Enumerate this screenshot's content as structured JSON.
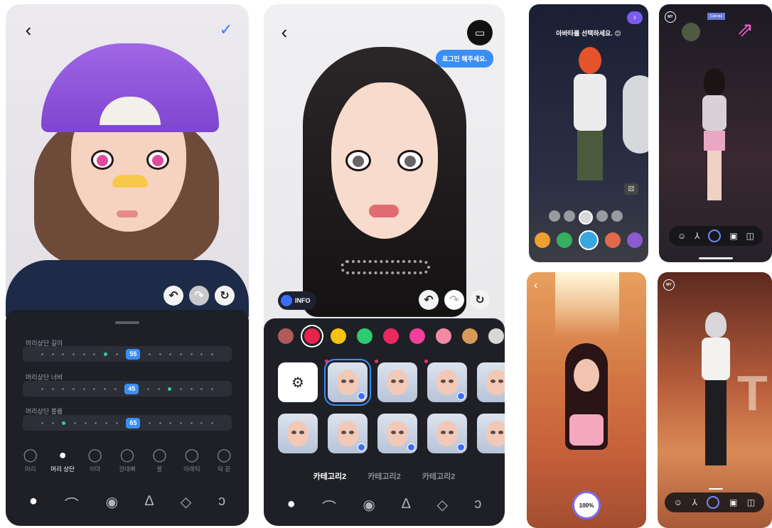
{
  "panel1": {
    "sliders": [
      {
        "label": "머리상단 길이",
        "value": "55"
      },
      {
        "label": "머리상단 너비",
        "value": "45"
      },
      {
        "label": "머리상단 볼륨",
        "value": "65"
      }
    ],
    "categories": [
      {
        "label": "머리",
        "icon": "head-outline-icon"
      },
      {
        "label": "머리 상단",
        "icon": "head-top-icon"
      },
      {
        "label": "이마",
        "icon": "forehead-icon"
      },
      {
        "label": "광대뼈",
        "icon": "cheekbone-icon"
      },
      {
        "label": "볼",
        "icon": "cheek-icon"
      },
      {
        "label": "아래턱",
        "icon": "jaw-icon"
      },
      {
        "label": "턱 끝",
        "icon": "chin-icon"
      }
    ],
    "active_category": "머리 상단",
    "tabs": [
      "face-icon",
      "eyebrow-icon",
      "eye-icon",
      "nose-icon",
      "lips-icon",
      "ear-icon"
    ]
  },
  "panel2": {
    "tooltip": "로그인 해주세요.",
    "info_label": "INFO",
    "swatches": [
      "#b05a5a",
      "#e8244e",
      "#f4c210",
      "#2ecc71",
      "#ea2a5e",
      "#f0409a",
      "#f28aa6",
      "#d79a58",
      "#d8d8d8"
    ],
    "tabs_text": [
      "카테고리2",
      "카테고리2",
      "카테고리2"
    ],
    "active_tab": "카테고리2"
  },
  "panel3a": {
    "title": "아바타를 선택하세요. 😊"
  },
  "panel3b": {
    "brand": "Canvas",
    "my_label": "MY"
  },
  "panel3c": {
    "progress": "100%"
  },
  "panel3d": {
    "my_label": "MY"
  }
}
